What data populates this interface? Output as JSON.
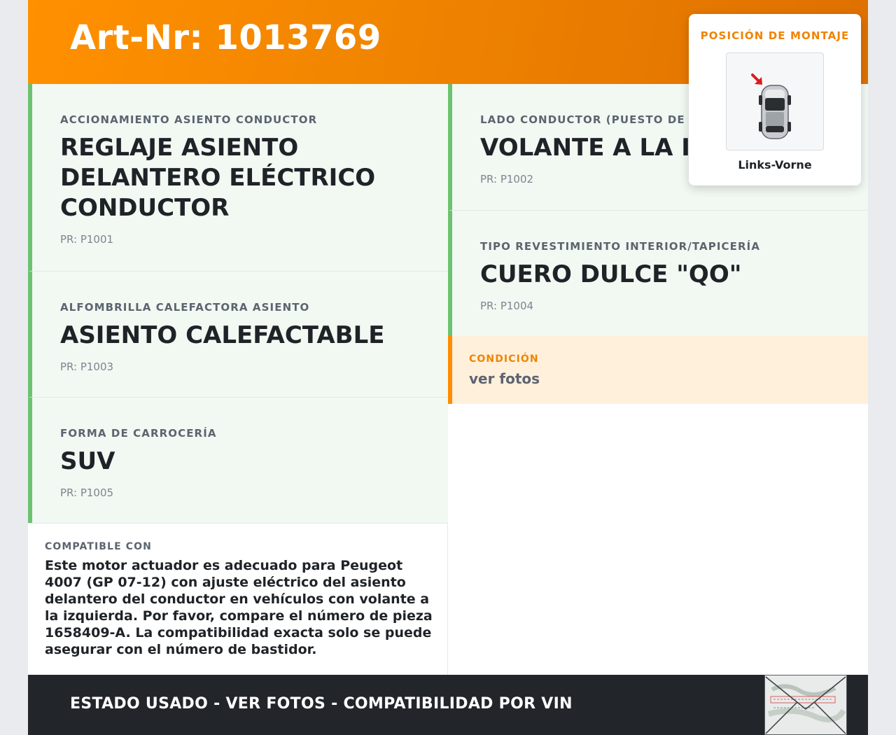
{
  "header": {
    "art_nr": "Art-Nr: 1013769"
  },
  "cards": [
    {
      "label": "ACCIONAMIENTO ASIENTO CONDUCTOR",
      "value": "REGLAJE ASIENTO DELANTERO ELÉCTRICO CONDUCTOR",
      "pr": "PR: P1001"
    },
    {
      "label": "ALFOMBRILLA CALEFACTORA ASIENTO",
      "value": "ASIENTO CALEFACTABLE",
      "pr": "PR: P1003"
    },
    {
      "label": "FORMA DE CARROCERÍA",
      "value": "SUV",
      "pr": "PR: P1005"
    },
    {
      "label": "LADO CONDUCTOR (PUESTO DE CONDUCCIÓN)",
      "value": "VOLANTE A LA IZQUIERDA",
      "pr": "PR: P1002"
    },
    {
      "label": "TIPO REVESTIMIENTO INTERIOR/TAPICERÍA",
      "value": "CUERO DULCE \"QO\"",
      "pr": "PR: P1004"
    }
  ],
  "condition": {
    "label": "CONDICIÓN",
    "text": "ver fotos"
  },
  "compat": {
    "label": "COMPATIBLE CON",
    "text": "Este motor actuador es adecuado para Peugeot 4007 (GP 07-12) con ajuste eléctrico del asiento delantero del conductor en vehículos con volante a la izquierda. Por favor, compare el número de pieza 1658409-A. La compatibilidad exacta solo se puede asegurar con el número de bastidor."
  },
  "footer": {
    "text": "ESTADO USADO - VER FOTOS - COMPATIBILIDAD POR VIN"
  },
  "mount": {
    "title": "POSICIÓN DE MONTAJE",
    "caption": "Links-Vorne",
    "icon": "car-top-view-front-left-arrow"
  },
  "colors": {
    "accent": "#ff8c00",
    "green": "#6cc270",
    "footer": "#22262b"
  }
}
